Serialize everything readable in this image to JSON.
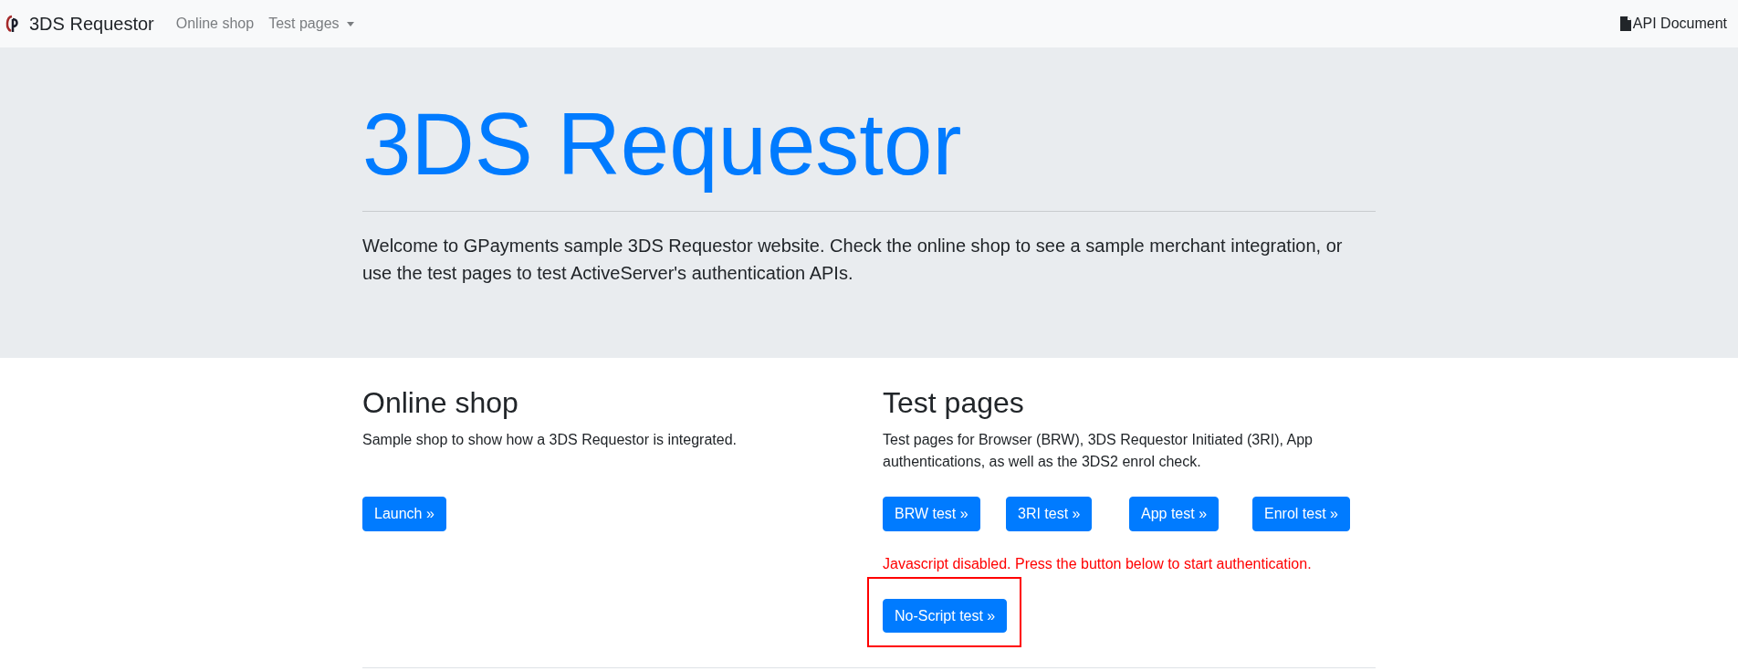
{
  "navbar": {
    "brand": "3DS Requestor",
    "links": [
      {
        "label": "Online shop",
        "kind": "link"
      },
      {
        "label": "Test pages",
        "kind": "dropdown"
      }
    ],
    "right_link": "API Document"
  },
  "jumbotron": {
    "title": "3DS Requestor",
    "lead": "Welcome to GPayments sample 3DS Requestor website. Check the online shop to see a sample merchant integration, or use the test pages to test ActiveServer's authentication APIs."
  },
  "sections": [
    {
      "heading": "Online shop",
      "text": "Sample shop to show how a 3DS Requestor is integrated.",
      "buttons": [
        {
          "label": "Launch »"
        }
      ]
    },
    {
      "heading": "Test pages",
      "text": "Test pages for Browser (BRW), 3DS Requestor Initiated (3RI), App authentications, as well as the 3DS2 enrol check.",
      "buttons": [
        {
          "label": "BRW test »"
        },
        {
          "label": "3RI test »"
        },
        {
          "label": "App test »"
        },
        {
          "label": "Enrol test »"
        }
      ],
      "warning": "Javascript disabled. Press the button below to start authentication.",
      "extra_button": {
        "label": "No-Script test »",
        "highlighted": true
      }
    }
  ]
}
